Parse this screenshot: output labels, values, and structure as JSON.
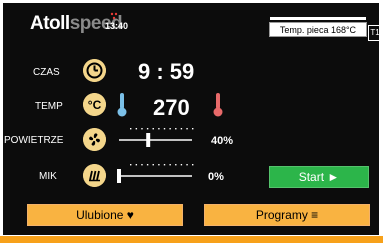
{
  "header": {
    "brand_part1": "Atoll",
    "brand_part2": "speed",
    "time": "13:40",
    "oven_temp": "Temp. pieca 168°C",
    "tray": "T1"
  },
  "rows": {
    "czas": {
      "label": "CZAS",
      "value": "9 : 59"
    },
    "temp": {
      "label": "TEMP",
      "value": "270"
    },
    "powietrze": {
      "label": "POWIETRZE",
      "value": "40%",
      "level": 0.4
    },
    "mik": {
      "label": "MIK",
      "value": "0%",
      "level": 0
    }
  },
  "buttons": {
    "start": "Start ►",
    "favourites": "Ulubione ♥",
    "programs": "Programy ≡"
  },
  "colors": {
    "background": "#0c0c0c",
    "accent_orange": "#f9b341",
    "accent_green": "#2cb54a",
    "icon_fill": "#f4d68b",
    "thermo_blue": "#7bc0e8",
    "thermo_red": "#e86a6a"
  },
  "icons": {
    "clock": "clock-icon",
    "temperature": "celsius-icon",
    "fan": "fan-icon",
    "microwave": "microwave-icon",
    "cold_thermometer": "cold-thermometer-icon",
    "hot_thermometer": "hot-thermometer-icon"
  }
}
